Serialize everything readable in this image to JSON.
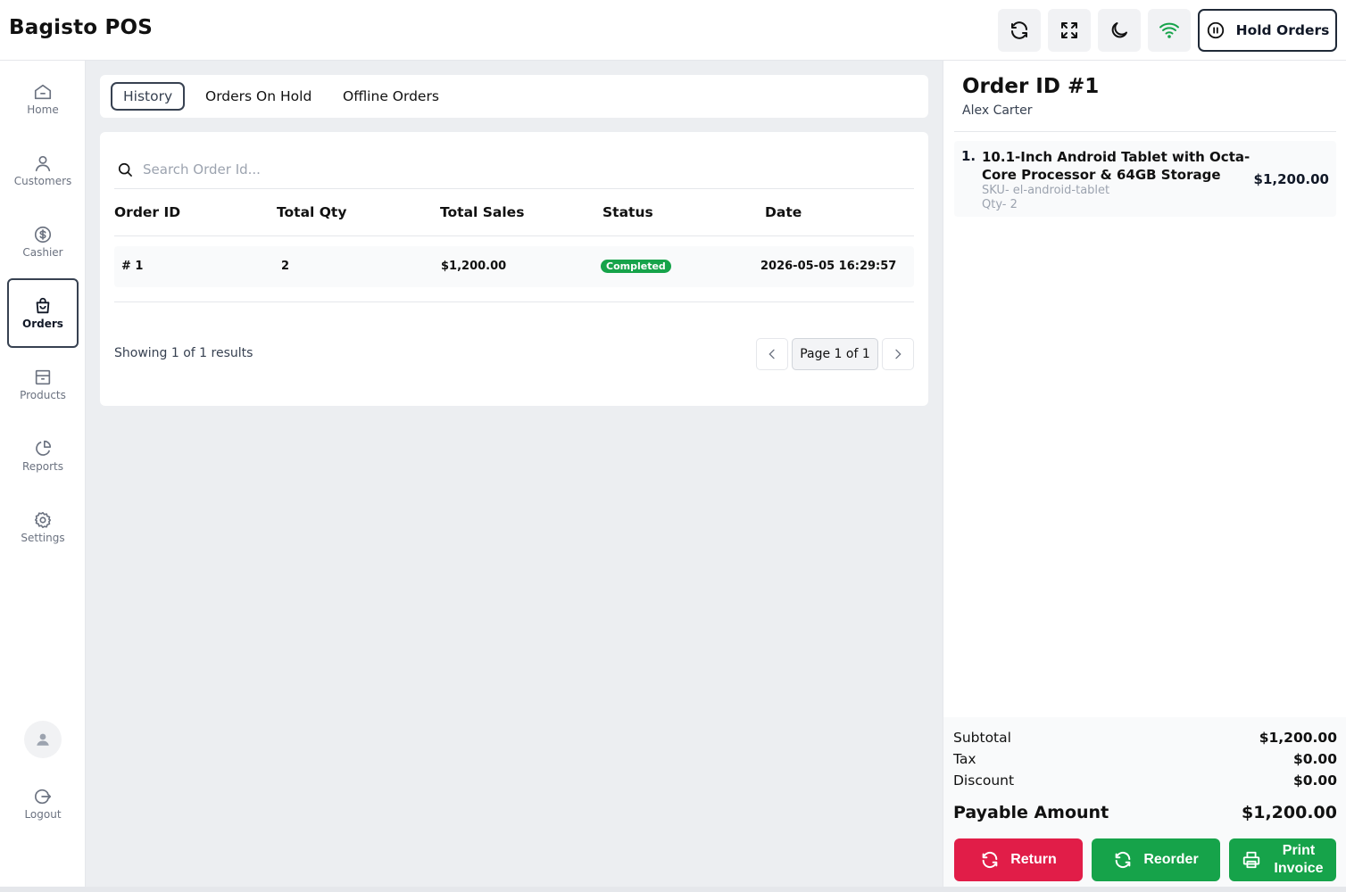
{
  "header": {
    "brand": "Bagisto POS",
    "hold_orders_label": "Hold Orders",
    "icons": [
      "refresh-icon",
      "fullscreen-icon",
      "moon-icon",
      "wifi-icon",
      "pause-icon"
    ],
    "wifi_color": "#16a34a"
  },
  "sidebar": {
    "items": [
      {
        "label": "Home",
        "icon": "home-icon"
      },
      {
        "label": "Customers",
        "icon": "user-icon"
      },
      {
        "label": "Cashier",
        "icon": "dollar-icon"
      },
      {
        "label": "Orders",
        "icon": "bag-icon",
        "active": true
      },
      {
        "label": "Products",
        "icon": "box-icon"
      },
      {
        "label": "Reports",
        "icon": "pie-chart-icon"
      },
      {
        "label": "Settings",
        "icon": "gear-icon"
      }
    ],
    "logout_label": "Logout"
  },
  "tabs": [
    "History",
    "Orders On Hold",
    "Offline Orders"
  ],
  "search": {
    "placeholder": "Search Order Id..."
  },
  "table": {
    "columns": [
      "Order ID",
      "Total Qty",
      "Total Sales",
      "Status",
      "Date"
    ],
    "rows": [
      {
        "order_id": "# 1",
        "total_qty": "2",
        "total_sales": "$1,200.00",
        "status": "Completed",
        "date": "2026-05-05 16:29:57"
      }
    ],
    "status_color": "#16a34a"
  },
  "pagination": {
    "showing": "Showing 1 of 1 results",
    "page_label": "Page 1 of 1"
  },
  "order_detail": {
    "title": "Order ID #1",
    "customer": "Alex Carter",
    "items": [
      {
        "num": "1.",
        "name": "10.1-Inch Android Tablet with Octa-Core Processor & 64GB Storage",
        "sku": "SKU- el-android-tablet",
        "qty": "Qty- 2",
        "price": "$1,200.00"
      }
    ],
    "subtotal_label": "Subtotal",
    "subtotal": "$1,200.00",
    "tax_label": "Tax",
    "tax": "$0.00",
    "discount_label": "Discount",
    "discount": "$0.00",
    "payable_label": "Payable Amount",
    "payable": "$1,200.00",
    "actions": {
      "return_label": "Return",
      "reorder_label": "Reorder",
      "print_label": "Print Invoice"
    },
    "colors": {
      "return": "#e11d48",
      "reorder": "#16a34a",
      "print": "#16a34a"
    }
  }
}
